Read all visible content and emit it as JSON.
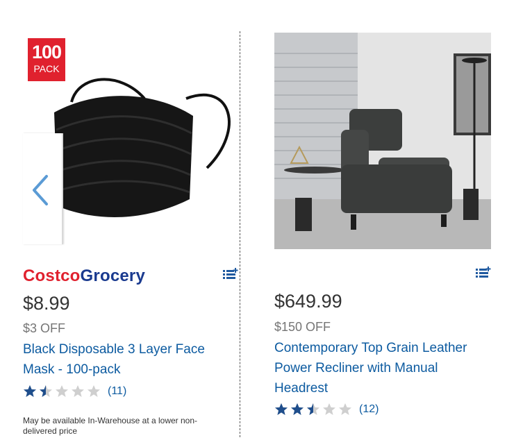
{
  "products": [
    {
      "badge": {
        "number": "100",
        "text": "PACK"
      },
      "brand": {
        "part1": "Costco",
        "part2": "Grocery"
      },
      "price": "$8.99",
      "discount": "$3 OFF",
      "title_lines": [
        "Black Disposable 3 Layer Face",
        "Mask - 100-pack"
      ],
      "rating": 1.5,
      "reviews": "(11)",
      "note_lines": [
        "May be available In-Warehouse at a lower non-",
        "delivered price"
      ]
    },
    {
      "price": "$649.99",
      "discount": "$150 OFF",
      "title_lines": [
        "Contemporary Top Grain Leather",
        "Power Recliner with Manual",
        "Headrest"
      ],
      "rating": 2.5,
      "reviews": "(12)"
    }
  ],
  "colors": {
    "link": "#0d5ba0",
    "costco_red": "#e0212e",
    "grocery_blue": "#1a3a8f",
    "star_filled": "#1f4e8c",
    "star_empty": "#cfcfcf"
  }
}
